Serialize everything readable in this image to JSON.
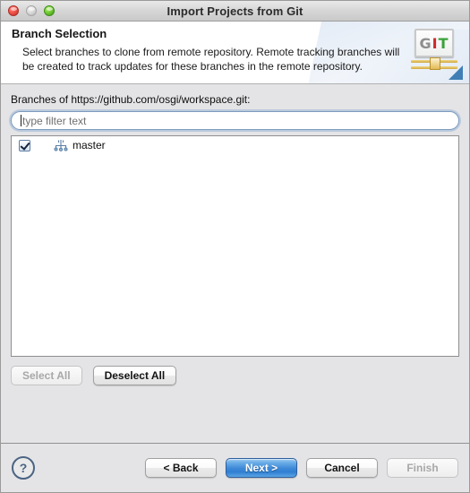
{
  "window": {
    "title": "Import Projects from Git",
    "controls": {
      "close": "close-button",
      "minimize": "minimize-button",
      "zoom": "zoom-button"
    }
  },
  "header": {
    "title": "Branch Selection",
    "description": "Select branches to clone from remote repository. Remote tracking branches will be created to track updates for these branches in the remote repository.",
    "logo": {
      "letter_g": "G",
      "letter_i": "I",
      "letter_t": "T",
      "colors": {
        "g": "#8e8e8e",
        "i": "#cf2828",
        "t": "#3aa23a",
        "bar": "#cfa73c",
        "triangle": "#3f7fb5"
      }
    }
  },
  "main": {
    "branches_label": "Branches of https://github.com/osgi/workspace.git:",
    "filter": {
      "placeholder": "type filter text",
      "value": ""
    },
    "branches": [
      {
        "label": "master",
        "checked": true,
        "icon": "git-branch-icon"
      }
    ],
    "select_all_label": "Select All",
    "select_all_enabled": false,
    "deselect_all_label": "Deselect All",
    "deselect_all_enabled": true
  },
  "footer": {
    "help_label": "?",
    "back_label": "< Back",
    "next_label": "Next >",
    "cancel_label": "Cancel",
    "finish_label": "Finish",
    "finish_enabled": false,
    "default_button": "next",
    "accent_color": "#3e8ad8"
  }
}
